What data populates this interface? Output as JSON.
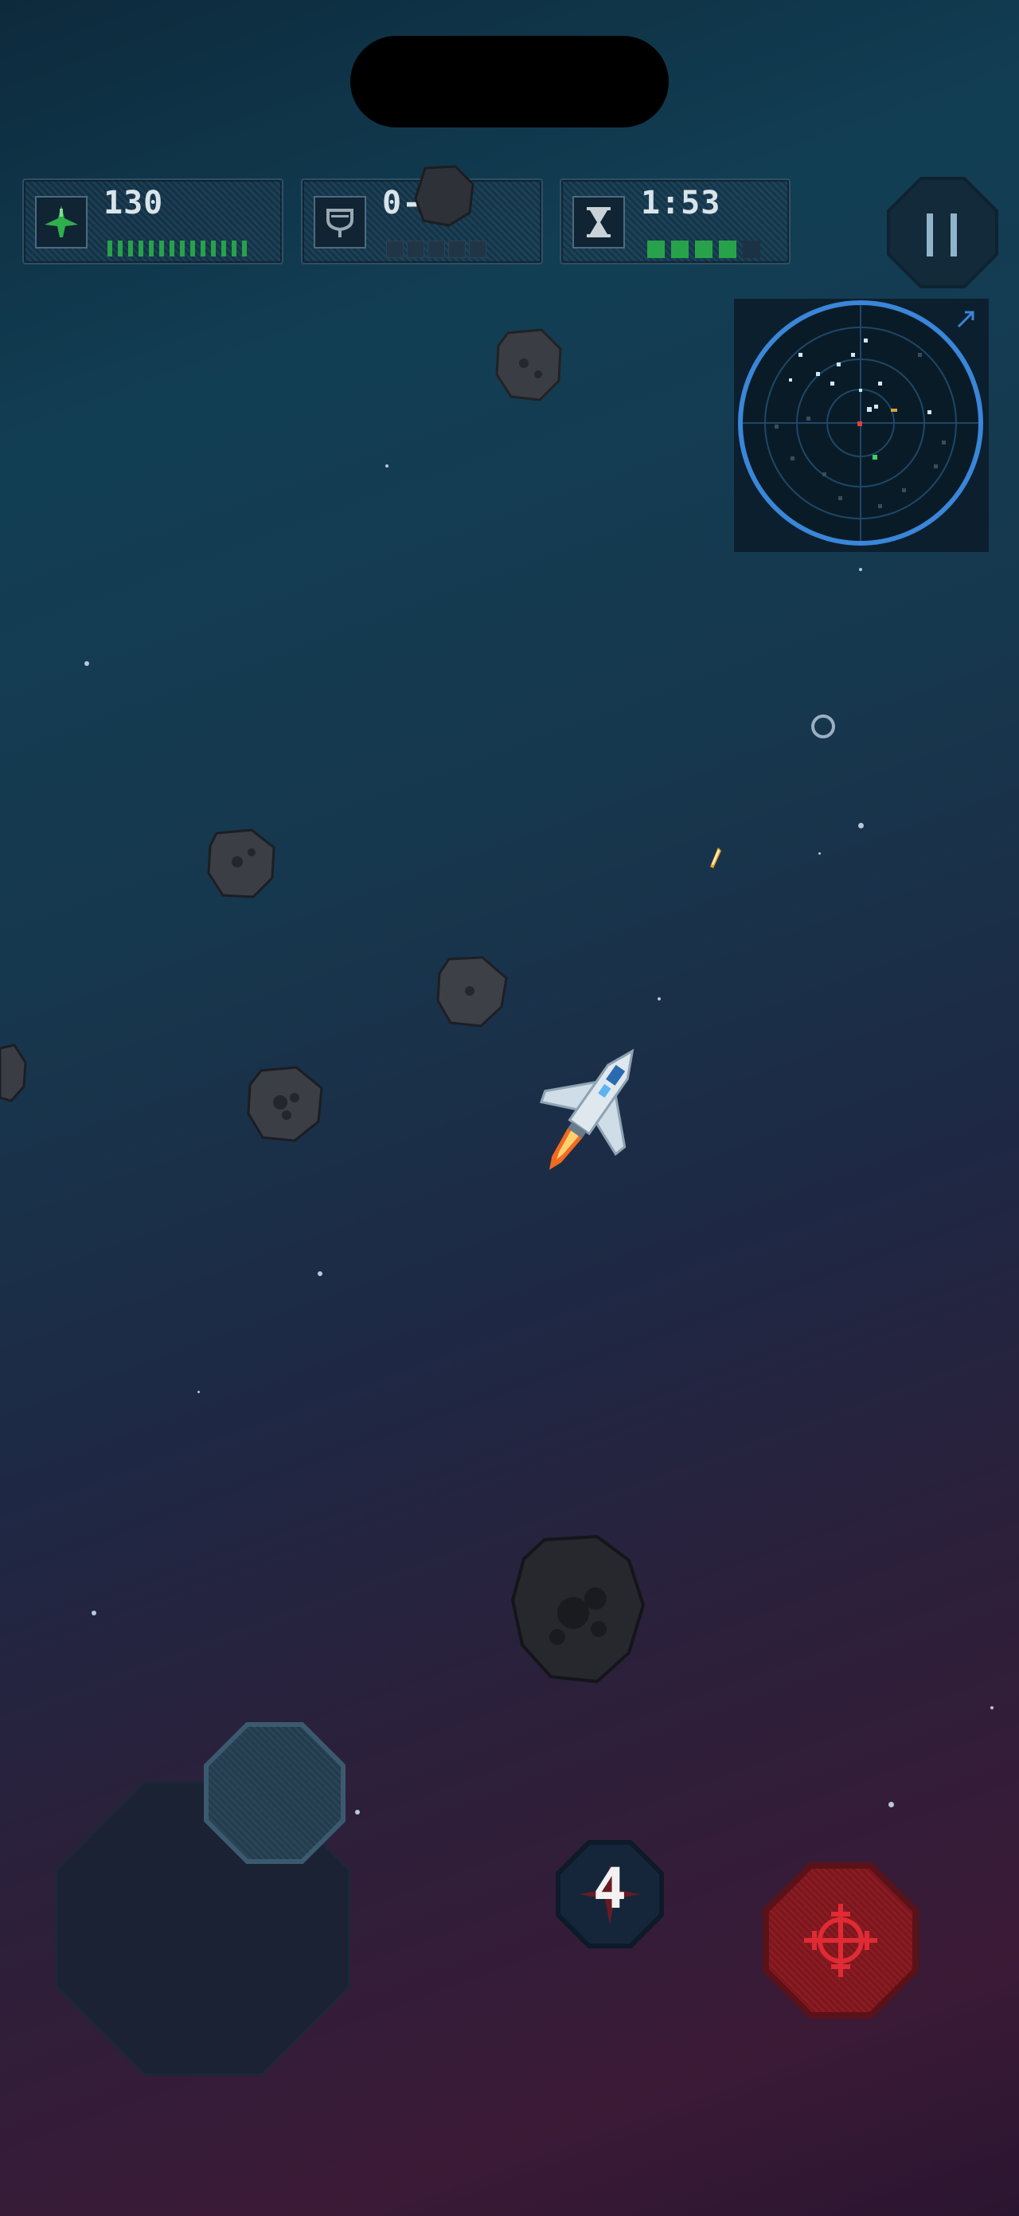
{
  "hud": {
    "score": {
      "value": "130",
      "icon": "ship-icon",
      "bar_ticks": 14
    },
    "kills": {
      "value": "0-0",
      "icon": "trophy-icon",
      "segments": 5,
      "filled": 0
    },
    "timer": {
      "value": "1:53",
      "icon": "hourglass-icon",
      "segments": 5,
      "filled": 4
    }
  },
  "controls": {
    "pause_icon": "pause-icon",
    "bomb_count": "4",
    "fire_icon": "crosshair-icon",
    "joystick": "virtual-joystick"
  },
  "colors": {
    "accent_green": "#27a24a",
    "radar_ring": "#3a86d8",
    "fire_red": "#8a1c22"
  }
}
